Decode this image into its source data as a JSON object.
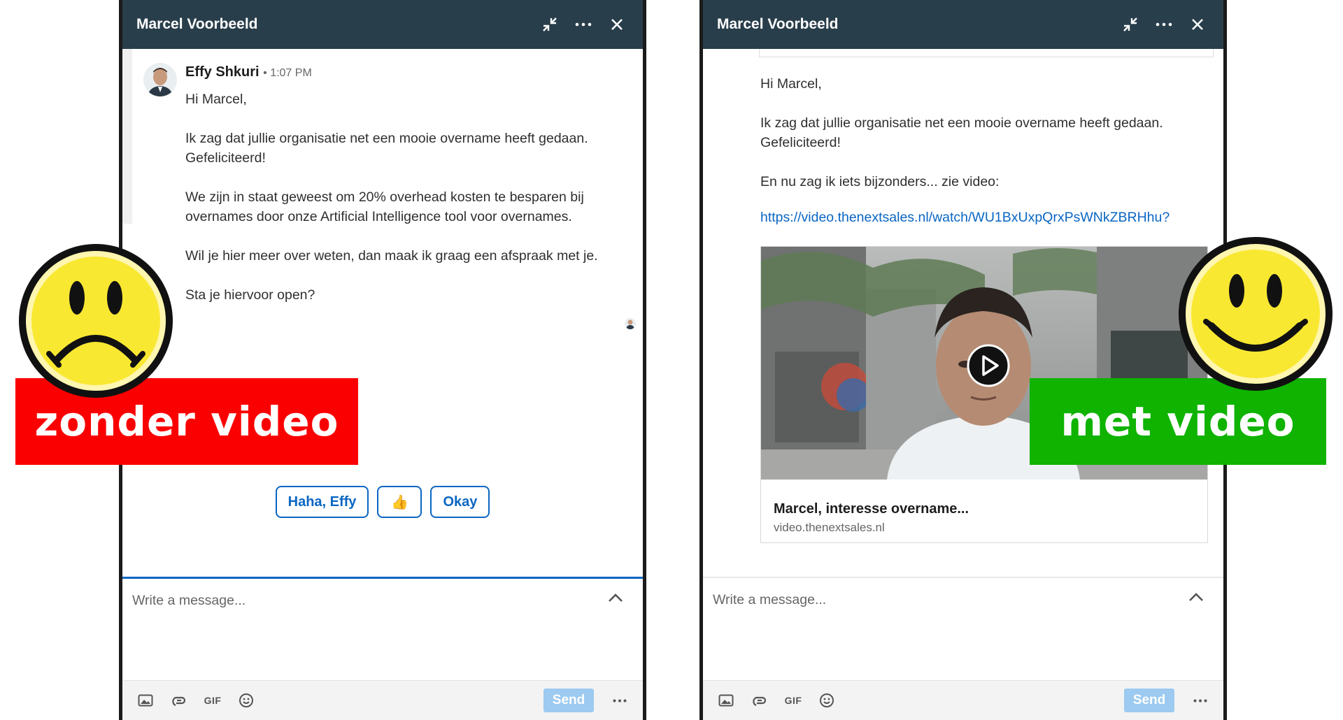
{
  "left_panel": {
    "header_title": "Marcel Voorbeeld",
    "sender_name": "Effy Shkuri",
    "sender_time": "• 1:07 PM",
    "message": [
      "Hi Marcel,",
      "Ik zag dat jullie organisatie net een mooie overname heeft gedaan. Gefeliciteerd!",
      "We zijn in staat geweest om 20% overhead kosten te besparen bij overnames door onze Artificial Intelligence tool voor overnames.",
      "Wil je hier meer over weten, dan maak ik graag een afspraak met je.",
      "Sta je hiervoor open?"
    ],
    "quick_replies": [
      "Haha, Effy",
      "👍",
      "Okay"
    ],
    "composer_placeholder": "Write a message...",
    "gif_label": "GIF",
    "send_label": "Send"
  },
  "right_panel": {
    "header_title": "Marcel Voorbeeld",
    "message": [
      "Hi Marcel,",
      "Ik zag dat jullie organisatie net een mooie overname heeft gedaan. Gefeliciteerd!",
      "En nu zag ik iets bijzonders... zie video:"
    ],
    "link": "https://video.thenextsales.nl/watch/WU1BxUxpQrxPsWNkZBRHhu?",
    "video_card": {
      "title": "Marcel, interesse overname...",
      "domain": "video.thenextsales.nl"
    },
    "composer_placeholder": "Write a message...",
    "gif_label": "GIF",
    "send_label": "Send"
  },
  "overlays": {
    "left_label": "zonder video",
    "right_label": "met video",
    "left_color": "#fb0000",
    "right_color": "#0fb300",
    "smiley_color": "#f9e832"
  },
  "icons": [
    "minimize-icon",
    "more-icon",
    "close-icon",
    "chevron-up-icon",
    "image-icon",
    "attachment-icon",
    "gif-icon",
    "emoji-icon",
    "play-icon"
  ],
  "colors": {
    "header_bg": "#293e4b",
    "accent": "#0a66c2",
    "send_disabled": "#9ccaf0"
  }
}
